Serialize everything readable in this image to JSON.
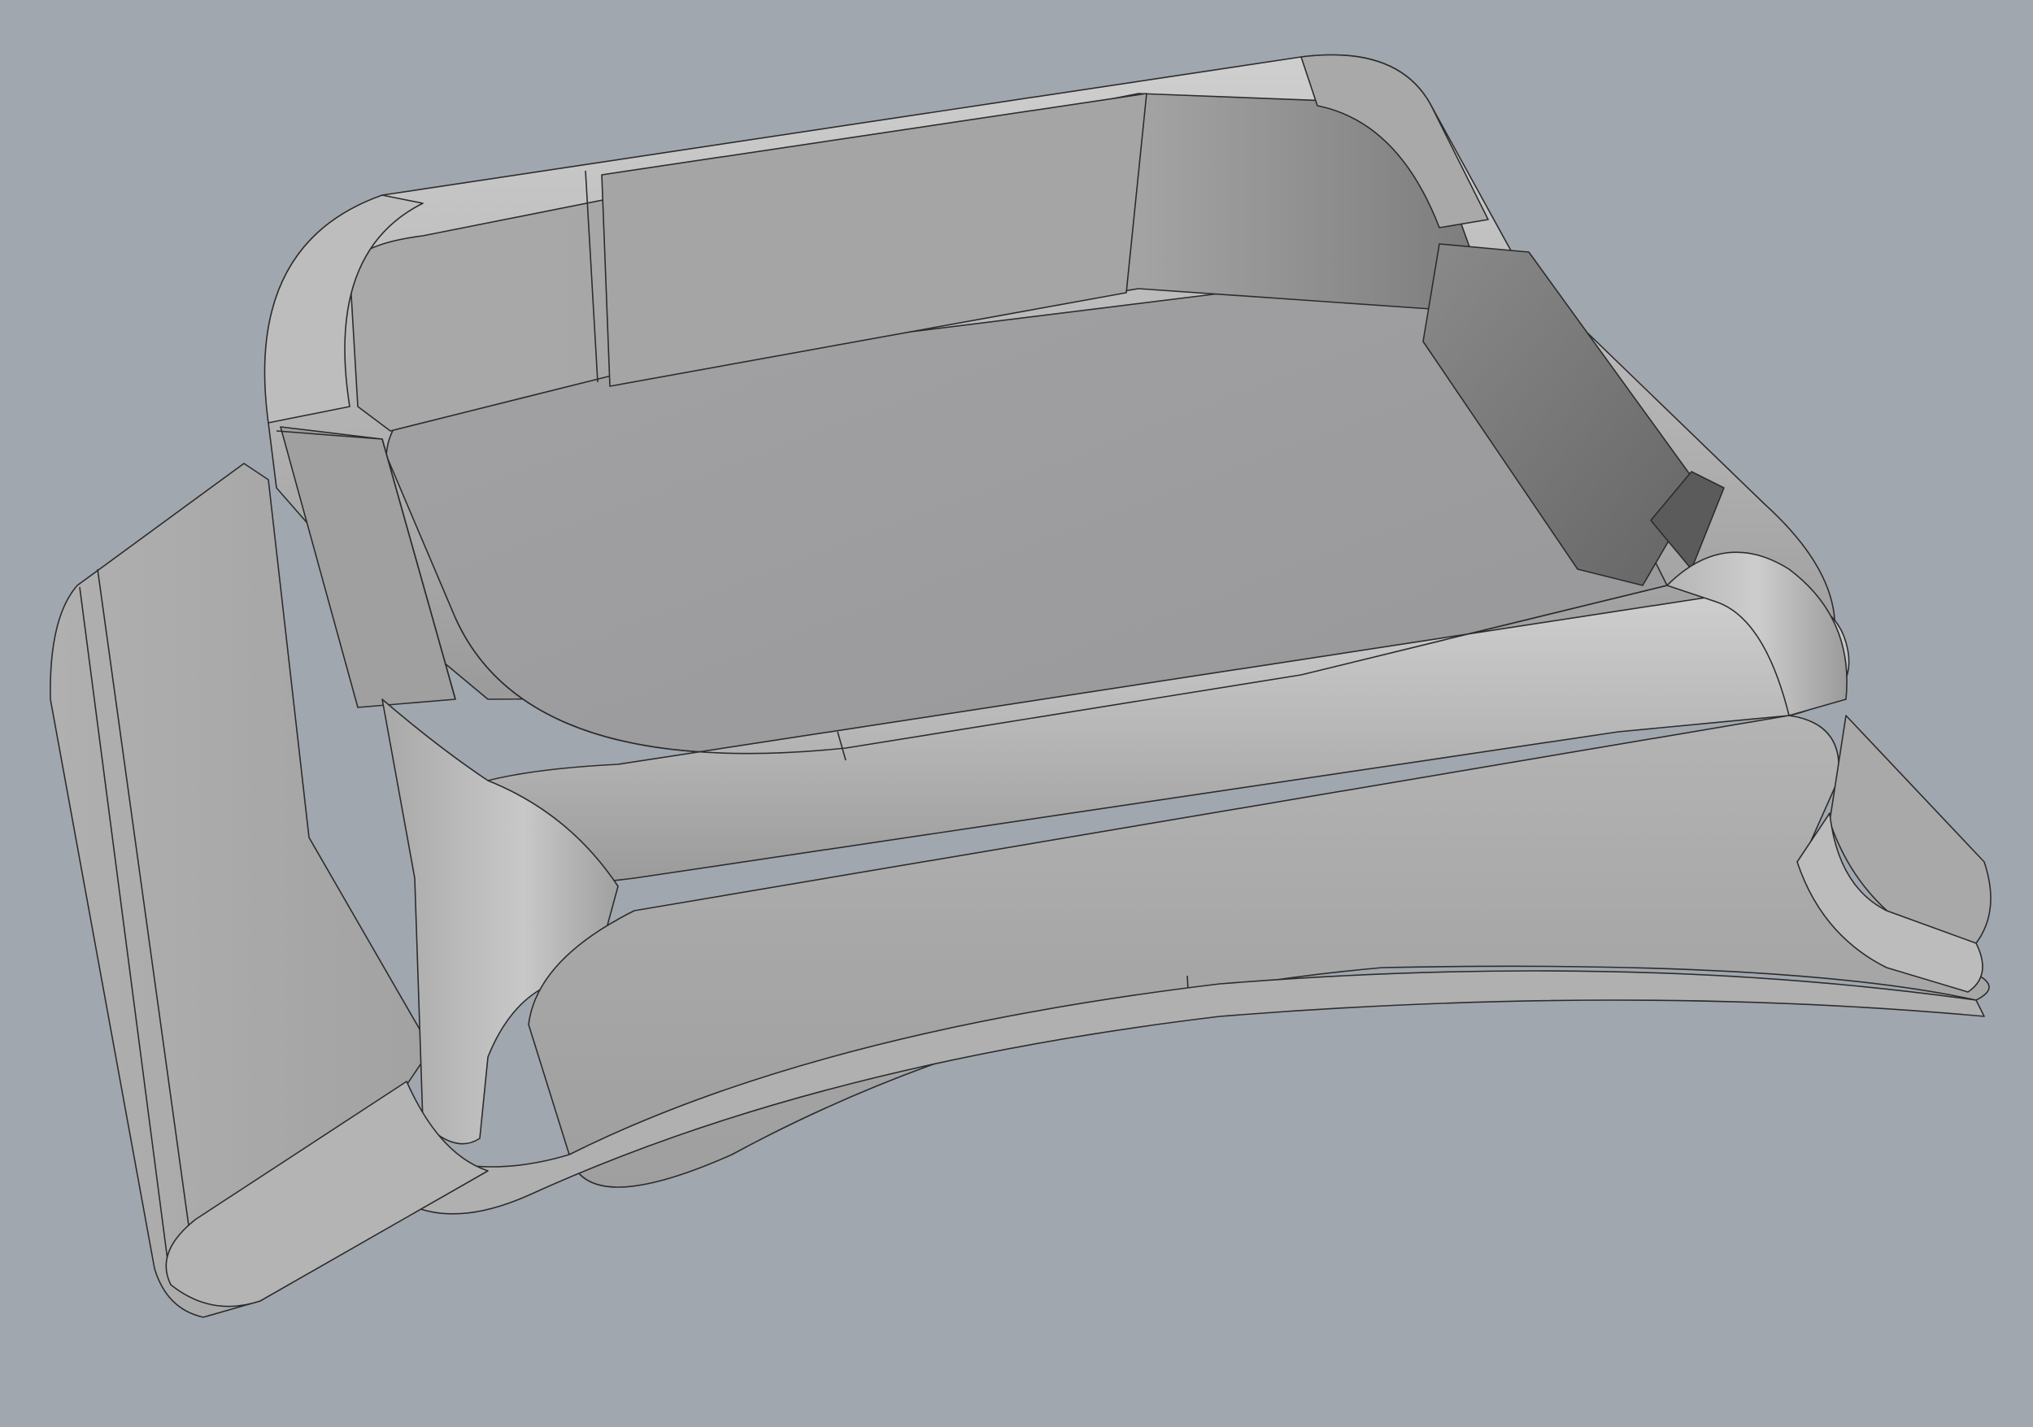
{
  "viewport": {
    "background": "#a1a7ae",
    "render_mode": "shaded-with-edges"
  },
  "model": {
    "name": "",
    "colors": {
      "body": "#a8a8a8",
      "body_light": "#c4c4c4",
      "body_dark": "#8e8e8e",
      "floor": "#9c9c9e",
      "inner_wall": "#a6a6a6",
      "inner_wall_dark": "#6e6e6e",
      "edge": "#2c2c2c"
    }
  }
}
